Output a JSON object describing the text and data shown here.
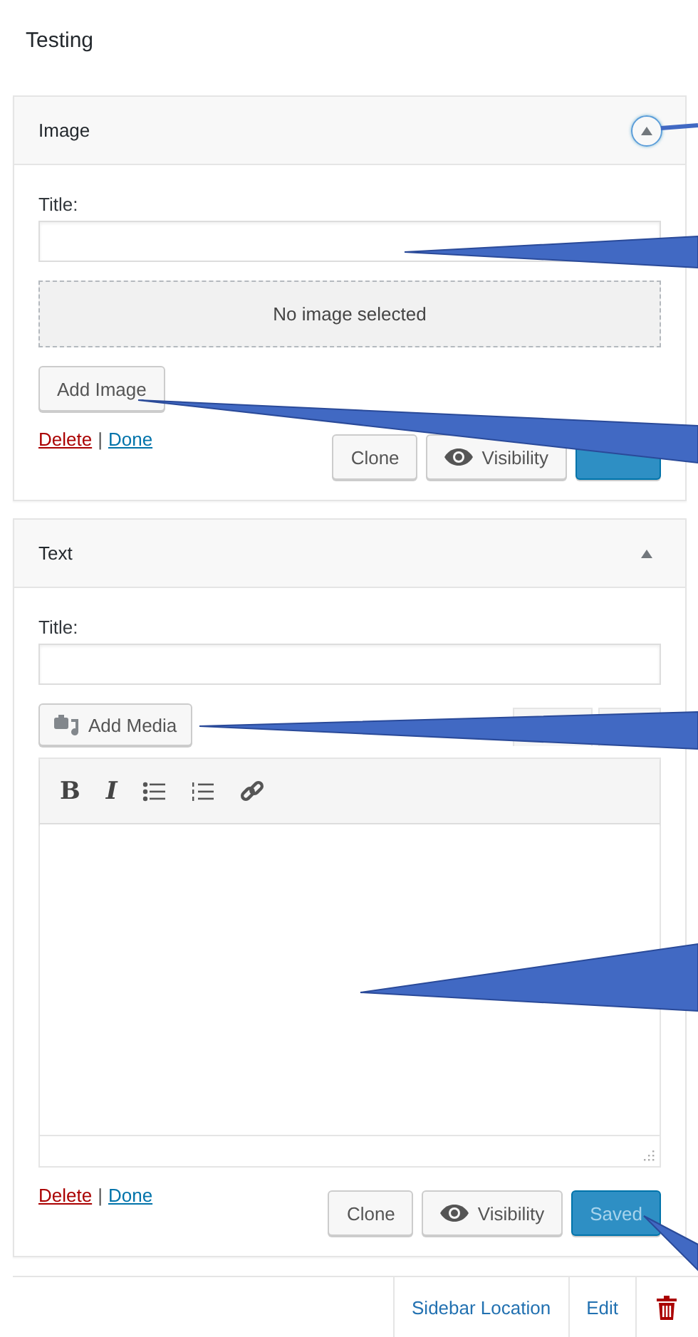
{
  "page_title": "Testing",
  "widgets": [
    {
      "title": "Image",
      "expanded": true,
      "focused": true,
      "separator": "|",
      "fields": [
        {
          "kind": "text",
          "label": "Title:"
        },
        {
          "kind": "image",
          "empty_text": "No image selected",
          "button": "Add Image"
        }
      ],
      "links": [
        {
          "label": "Delete",
          "kind": "danger"
        },
        {
          "label": "Done",
          "kind": "normal"
        }
      ],
      "buttons": [
        {
          "kind": "default",
          "label": "Clone"
        },
        {
          "kind": "visibility",
          "label": "Visibility"
        },
        {
          "kind": "primary"
        }
      ]
    },
    {
      "title": "Text",
      "expanded": true,
      "focused": false,
      "separator": "|",
      "fields": [
        {
          "kind": "text",
          "label": "Title:"
        },
        {
          "kind": "editor",
          "media_button": "Add Media",
          "toolbar": [
            {
              "kind": "bold",
              "label": "B"
            },
            {
              "kind": "italic",
              "label": "I"
            },
            {
              "kind": "bullets"
            },
            {
              "kind": "numbers"
            },
            {
              "kind": "link"
            }
          ]
        }
      ],
      "links": [
        {
          "label": "Delete",
          "kind": "danger"
        },
        {
          "label": "Done",
          "kind": "normal"
        }
      ],
      "buttons": [
        {
          "kind": "default",
          "label": "Clone"
        },
        {
          "kind": "visibility",
          "label": "Visibility"
        },
        {
          "kind": "primary",
          "label": "Saved"
        }
      ]
    }
  ],
  "footer_bar": {
    "links": [
      "Sidebar Location",
      "Edit"
    ]
  }
}
